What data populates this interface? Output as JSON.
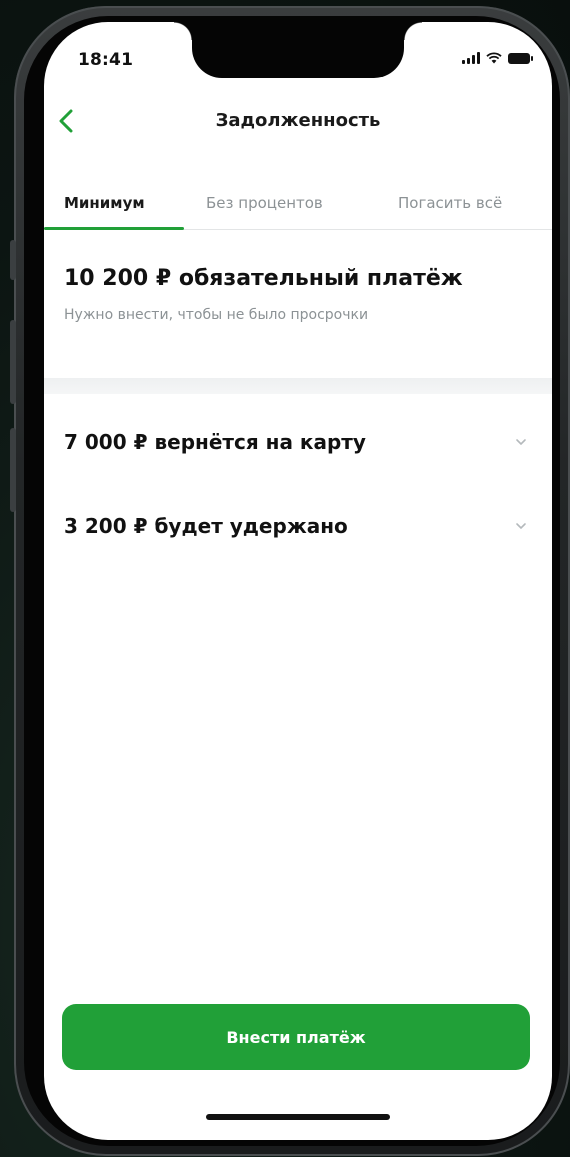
{
  "status_bar": {
    "time": "18:41"
  },
  "nav": {
    "title": "Задолженность",
    "back_icon": "chevron-left-icon"
  },
  "tabs": [
    {
      "label": "Минимум",
      "active": true
    },
    {
      "label": "Без процентов",
      "active": false
    },
    {
      "label": "Погасить всё",
      "active": false
    }
  ],
  "summary": {
    "title": "10 200 ₽ обязательный платёж",
    "subtitle": "Нужно внести, чтобы не было просрочки"
  },
  "breakdown": [
    {
      "label": "7 000 ₽ вернётся на карту",
      "icon": "chevron-down-icon"
    },
    {
      "label": "3 200 ₽ будет удержано",
      "icon": "chevron-down-icon"
    }
  ],
  "action": {
    "pay_label": "Внести платёж"
  },
  "colors": {
    "accent": "#21a038",
    "text_primary": "#111111",
    "text_secondary": "#8c9295",
    "background": "#ffffff"
  }
}
